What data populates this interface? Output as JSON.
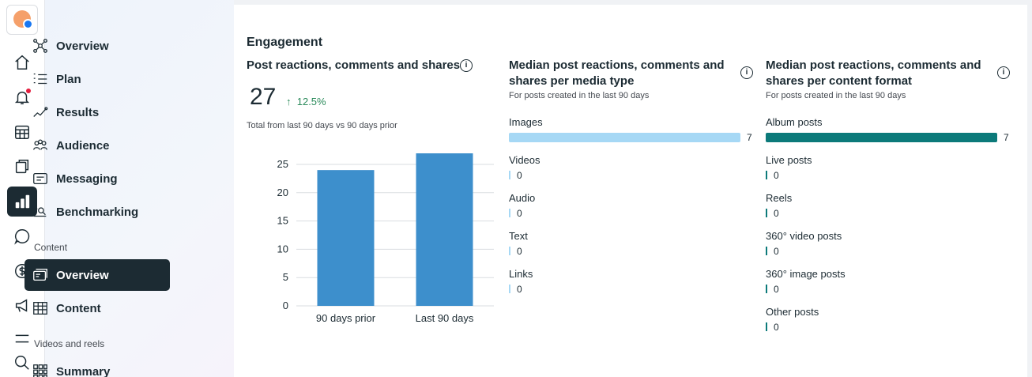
{
  "nav": {
    "items": [
      {
        "label": "Overview",
        "icon": "network-icon"
      },
      {
        "label": "Plan",
        "icon": "list-icon"
      },
      {
        "label": "Results",
        "icon": "trend-icon"
      },
      {
        "label": "Audience",
        "icon": "people-icon"
      },
      {
        "label": "Messaging",
        "icon": "message-icon"
      },
      {
        "label": "Benchmarking",
        "icon": "benchmark-icon"
      }
    ],
    "content_section": "Content",
    "content_items": [
      {
        "label": "Overview",
        "icon": "cards-icon",
        "active": true
      },
      {
        "label": "Content",
        "icon": "table-icon"
      }
    ],
    "videos_section": "Videos and reels",
    "videos_items": [
      {
        "label": "Summary",
        "icon": "grid-icon"
      }
    ]
  },
  "rail": {
    "icons": [
      "home-icon",
      "bell-icon",
      "calendar-icon",
      "posts-icon",
      "insights-icon",
      "chat-icon",
      "dollar-icon",
      "megaphone-icon",
      "menu-icon",
      "search-icon"
    ],
    "active": "insights-icon"
  },
  "engagement": {
    "heading": "Engagement",
    "card1": {
      "title": "Post reactions, comments and shares",
      "total": "27",
      "delta": "12.5%",
      "note": "Total from last 90 days vs 90 days prior"
    },
    "card2": {
      "title_line1": "Median post reactions, comments and",
      "title_line2": "shares per media type",
      "note": "For posts created in the last 90 days",
      "color": "#a6d8f5",
      "rows": [
        {
          "label": "Images",
          "value": "7"
        },
        {
          "label": "Videos",
          "value": "0"
        },
        {
          "label": "Audio",
          "value": "0"
        },
        {
          "label": "Text",
          "value": "0"
        },
        {
          "label": "Links",
          "value": "0"
        }
      ]
    },
    "card3": {
      "title_line1": "Median post reactions, comments and",
      "title_line2": "shares per content format",
      "note": "For posts created in the last 90 days",
      "color": "#0c7a7a",
      "rows": [
        {
          "label": "Album posts",
          "value": "7"
        },
        {
          "label": "Live posts",
          "value": "0"
        },
        {
          "label": "Reels",
          "value": "0"
        },
        {
          "label": "360° video posts",
          "value": "0"
        },
        {
          "label": "360° image posts",
          "value": "0"
        },
        {
          "label": "Other posts",
          "value": "0"
        }
      ]
    }
  },
  "chart_data": {
    "type": "bar",
    "categories": [
      "90 days prior",
      "Last 90 days"
    ],
    "values": [
      24,
      27
    ],
    "ylim": [
      0,
      25
    ],
    "yticks": [
      "0",
      "5",
      "10",
      "15",
      "20",
      "25"
    ],
    "grid": true,
    "bar_color": "#3d8fcc"
  }
}
